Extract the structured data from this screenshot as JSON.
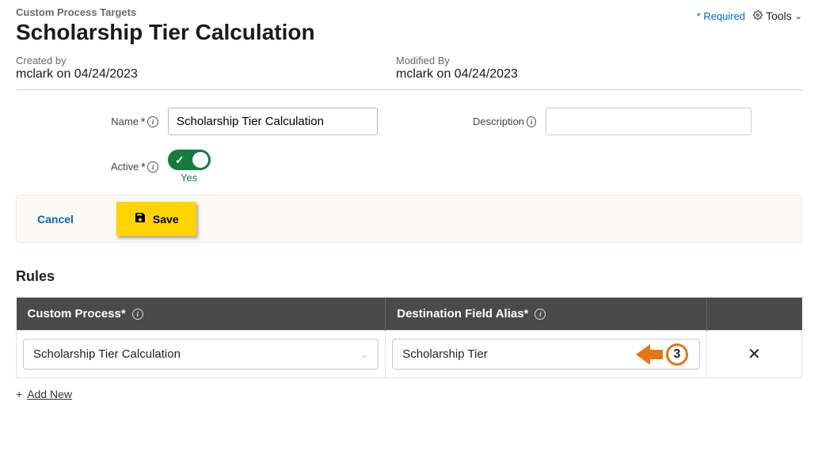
{
  "breadcrumb": "Custom Process Targets",
  "page_title": "Scholarship Tier Calculation",
  "required_note": "* Required",
  "tools_label": "Tools",
  "meta": {
    "created_by_label": "Created by",
    "created_by_value": "mclark on 04/24/2023",
    "modified_by_label": "Modified By",
    "modified_by_value": "mclark on 04/24/2023"
  },
  "form": {
    "name_label": "Name",
    "name_value": "Scholarship Tier Calculation",
    "description_label": "Description",
    "description_value": "",
    "active_label": "Active",
    "active_text": "Yes"
  },
  "actions": {
    "cancel": "Cancel",
    "save": "Save"
  },
  "rules": {
    "heading": "Rules",
    "col_custom_process": "Custom Process*",
    "col_destination": "Destination Field Alias*",
    "row1_process": "Scholarship Tier Calculation",
    "row1_destination": "Scholarship Tier",
    "add_new": "Add New",
    "callout_number": "3"
  }
}
